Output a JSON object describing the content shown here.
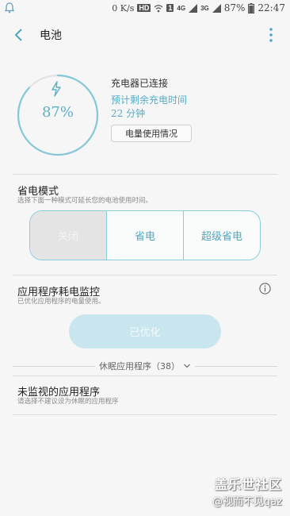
{
  "status_bar": {
    "notif_icon": "bell-ring-icon",
    "speed": "0 K/s",
    "hd_badge": "HD",
    "sim": "1",
    "net_a": "4G",
    "net_b": "3G",
    "battery_pct": "87%",
    "time": "22:47"
  },
  "appbar": {
    "title": "电池",
    "back_icon": "chevron-left-icon",
    "more_icon": "more-vertical-icon"
  },
  "battery": {
    "percent_text": "87%",
    "level": 0.87,
    "bolt_icon": "lightning-bolt-icon",
    "status": "充电器已连接",
    "remaining_label": "预计剩余充电时间",
    "remaining_value": "22  分钟",
    "usage_button": "电量使用情况"
  },
  "power_saving": {
    "title": "省电模式",
    "subtitle": "选择下面一种模式可延长您的电池使用时间。",
    "modes": [
      "关闭",
      "省电",
      "超级省电"
    ],
    "selected": "关闭"
  },
  "app_monitor": {
    "title": "应用程序耗电监控",
    "subtitle": "已优化应用程序的电量使用。",
    "info_icon": "info-circle-icon",
    "button": "已优化",
    "dormant_label": "休眠应用程序（38）",
    "dormant_icon": "chevron-down-icon",
    "unmonitored_title": "未监视的应用程序",
    "unmonitored_subtitle": "请选择不建议设为休眠的应用程序"
  },
  "watermark": {
    "main": "盖乐世社区",
    "sub": "@视而不见qaz"
  },
  "colors": {
    "accent": "#55acc6",
    "ring": "#86c7d9",
    "button_disabled": "#c9e6ee",
    "background": "#f6f6f6"
  }
}
